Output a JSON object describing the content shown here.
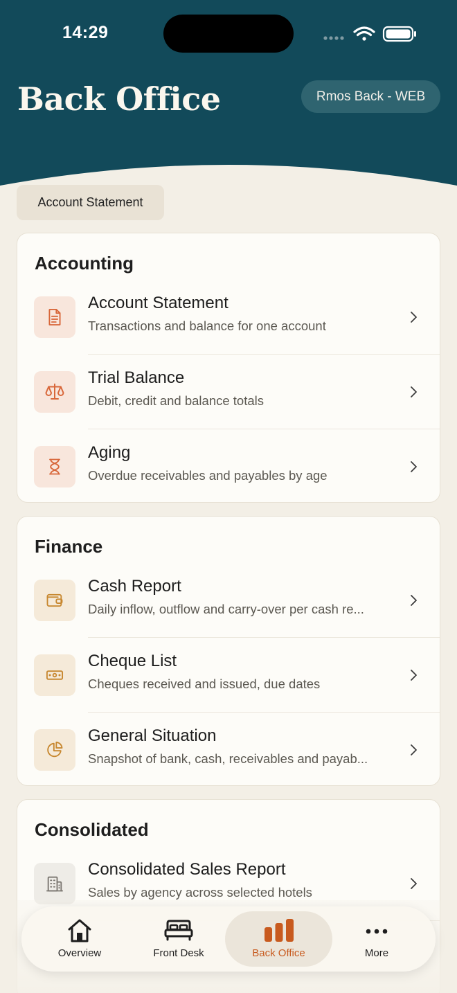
{
  "status_bar": {
    "time": "14:29"
  },
  "header": {
    "title": "Back Office",
    "environment": "Rmos Back - WEB"
  },
  "chip": {
    "label": "Account Statement"
  },
  "sections": [
    {
      "title": "Accounting",
      "items": [
        {
          "title": "Account Statement",
          "subtitle": "Transactions and balance for one account",
          "icon": "document-icon"
        },
        {
          "title": "Trial Balance",
          "subtitle": "Debit, credit and balance totals",
          "icon": "scale-icon"
        },
        {
          "title": "Aging",
          "subtitle": "Overdue receivables and payables by age",
          "icon": "hourglass-icon"
        }
      ]
    },
    {
      "title": "Finance",
      "items": [
        {
          "title": "Cash Report",
          "subtitle": "Daily inflow, outflow and carry-over per cash re...",
          "icon": "wallet-icon"
        },
        {
          "title": "Cheque List",
          "subtitle": "Cheques received and issued, due dates",
          "icon": "banknote-icon"
        },
        {
          "title": "General Situation",
          "subtitle": "Snapshot of bank, cash, receivables and payab...",
          "icon": "pie-chart-icon"
        }
      ]
    },
    {
      "title": "Consolidated",
      "items": [
        {
          "title": "Consolidated Sales Report",
          "subtitle": "Sales by agency across selected hotels",
          "icon": "building-icon"
        }
      ]
    }
  ],
  "tabbar": {
    "items": [
      {
        "label": "Overview",
        "icon": "home-icon",
        "active": false
      },
      {
        "label": "Front Desk",
        "icon": "bed-icon",
        "active": false
      },
      {
        "label": "Back Office",
        "icon": "bar-chart-icon",
        "active": true
      },
      {
        "label": "More",
        "icon": "more-icon",
        "active": false
      }
    ]
  },
  "colors": {
    "header_bg": "#124a5a",
    "page_bg": "#f3efe6",
    "accent": "#c85a1e",
    "accounting_icon": "#d8673a",
    "finance_icon": "#c7872f",
    "consolidated_icon": "#7a7670"
  }
}
